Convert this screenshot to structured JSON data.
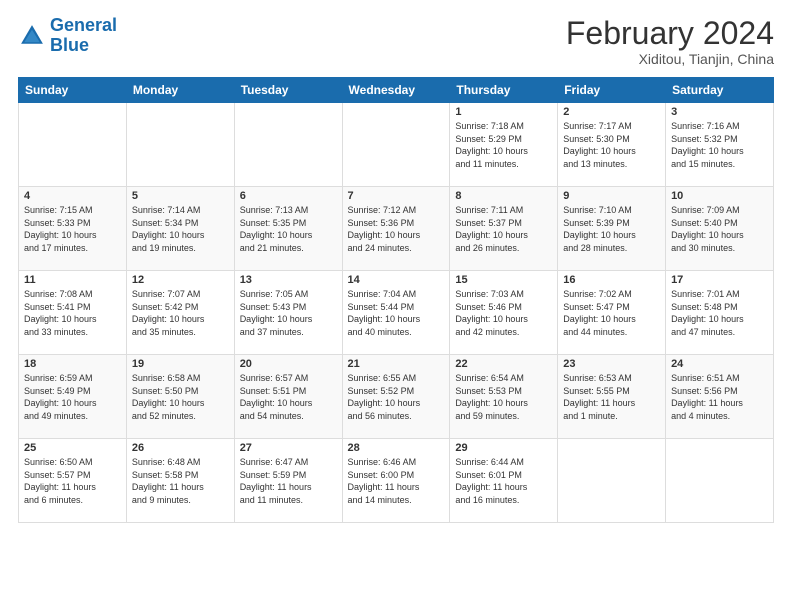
{
  "logo": {
    "line1": "General",
    "line2": "Blue"
  },
  "title": "February 2024",
  "subtitle": "Xiditou, Tianjin, China",
  "weekdays": [
    "Sunday",
    "Monday",
    "Tuesday",
    "Wednesday",
    "Thursday",
    "Friday",
    "Saturday"
  ],
  "weeks": [
    [
      {
        "day": "",
        "info": ""
      },
      {
        "day": "",
        "info": ""
      },
      {
        "day": "",
        "info": ""
      },
      {
        "day": "",
        "info": ""
      },
      {
        "day": "1",
        "info": "Sunrise: 7:18 AM\nSunset: 5:29 PM\nDaylight: 10 hours\nand 11 minutes."
      },
      {
        "day": "2",
        "info": "Sunrise: 7:17 AM\nSunset: 5:30 PM\nDaylight: 10 hours\nand 13 minutes."
      },
      {
        "day": "3",
        "info": "Sunrise: 7:16 AM\nSunset: 5:32 PM\nDaylight: 10 hours\nand 15 minutes."
      }
    ],
    [
      {
        "day": "4",
        "info": "Sunrise: 7:15 AM\nSunset: 5:33 PM\nDaylight: 10 hours\nand 17 minutes."
      },
      {
        "day": "5",
        "info": "Sunrise: 7:14 AM\nSunset: 5:34 PM\nDaylight: 10 hours\nand 19 minutes."
      },
      {
        "day": "6",
        "info": "Sunrise: 7:13 AM\nSunset: 5:35 PM\nDaylight: 10 hours\nand 21 minutes."
      },
      {
        "day": "7",
        "info": "Sunrise: 7:12 AM\nSunset: 5:36 PM\nDaylight: 10 hours\nand 24 minutes."
      },
      {
        "day": "8",
        "info": "Sunrise: 7:11 AM\nSunset: 5:37 PM\nDaylight: 10 hours\nand 26 minutes."
      },
      {
        "day": "9",
        "info": "Sunrise: 7:10 AM\nSunset: 5:39 PM\nDaylight: 10 hours\nand 28 minutes."
      },
      {
        "day": "10",
        "info": "Sunrise: 7:09 AM\nSunset: 5:40 PM\nDaylight: 10 hours\nand 30 minutes."
      }
    ],
    [
      {
        "day": "11",
        "info": "Sunrise: 7:08 AM\nSunset: 5:41 PM\nDaylight: 10 hours\nand 33 minutes."
      },
      {
        "day": "12",
        "info": "Sunrise: 7:07 AM\nSunset: 5:42 PM\nDaylight: 10 hours\nand 35 minutes."
      },
      {
        "day": "13",
        "info": "Sunrise: 7:05 AM\nSunset: 5:43 PM\nDaylight: 10 hours\nand 37 minutes."
      },
      {
        "day": "14",
        "info": "Sunrise: 7:04 AM\nSunset: 5:44 PM\nDaylight: 10 hours\nand 40 minutes."
      },
      {
        "day": "15",
        "info": "Sunrise: 7:03 AM\nSunset: 5:46 PM\nDaylight: 10 hours\nand 42 minutes."
      },
      {
        "day": "16",
        "info": "Sunrise: 7:02 AM\nSunset: 5:47 PM\nDaylight: 10 hours\nand 44 minutes."
      },
      {
        "day": "17",
        "info": "Sunrise: 7:01 AM\nSunset: 5:48 PM\nDaylight: 10 hours\nand 47 minutes."
      }
    ],
    [
      {
        "day": "18",
        "info": "Sunrise: 6:59 AM\nSunset: 5:49 PM\nDaylight: 10 hours\nand 49 minutes."
      },
      {
        "day": "19",
        "info": "Sunrise: 6:58 AM\nSunset: 5:50 PM\nDaylight: 10 hours\nand 52 minutes."
      },
      {
        "day": "20",
        "info": "Sunrise: 6:57 AM\nSunset: 5:51 PM\nDaylight: 10 hours\nand 54 minutes."
      },
      {
        "day": "21",
        "info": "Sunrise: 6:55 AM\nSunset: 5:52 PM\nDaylight: 10 hours\nand 56 minutes."
      },
      {
        "day": "22",
        "info": "Sunrise: 6:54 AM\nSunset: 5:53 PM\nDaylight: 10 hours\nand 59 minutes."
      },
      {
        "day": "23",
        "info": "Sunrise: 6:53 AM\nSunset: 5:55 PM\nDaylight: 11 hours\nand 1 minute."
      },
      {
        "day": "24",
        "info": "Sunrise: 6:51 AM\nSunset: 5:56 PM\nDaylight: 11 hours\nand 4 minutes."
      }
    ],
    [
      {
        "day": "25",
        "info": "Sunrise: 6:50 AM\nSunset: 5:57 PM\nDaylight: 11 hours\nand 6 minutes."
      },
      {
        "day": "26",
        "info": "Sunrise: 6:48 AM\nSunset: 5:58 PM\nDaylight: 11 hours\nand 9 minutes."
      },
      {
        "day": "27",
        "info": "Sunrise: 6:47 AM\nSunset: 5:59 PM\nDaylight: 11 hours\nand 11 minutes."
      },
      {
        "day": "28",
        "info": "Sunrise: 6:46 AM\nSunset: 6:00 PM\nDaylight: 11 hours\nand 14 minutes."
      },
      {
        "day": "29",
        "info": "Sunrise: 6:44 AM\nSunset: 6:01 PM\nDaylight: 11 hours\nand 16 minutes."
      },
      {
        "day": "",
        "info": ""
      },
      {
        "day": "",
        "info": ""
      }
    ]
  ]
}
